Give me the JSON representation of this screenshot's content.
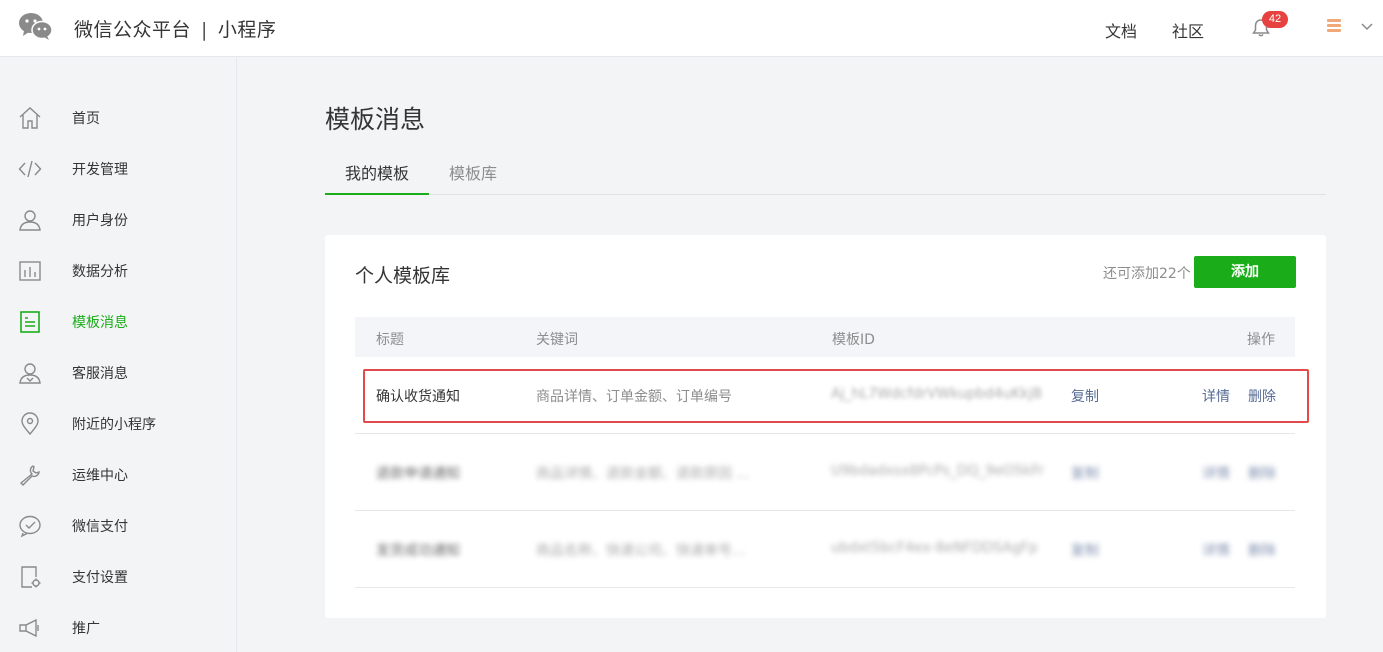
{
  "header": {
    "brand": "微信公众平台",
    "separator": "|",
    "product": "小程序",
    "links": {
      "docs": "文档",
      "community": "社区"
    },
    "notification_count": "42"
  },
  "sidebar": {
    "items": [
      {
        "label": "首页",
        "icon": "home-icon"
      },
      {
        "label": "开发管理",
        "icon": "code-icon"
      },
      {
        "label": "用户身份",
        "icon": "user-icon"
      },
      {
        "label": "数据分析",
        "icon": "chart-icon"
      },
      {
        "label": "模板消息",
        "icon": "template-icon",
        "active": true
      },
      {
        "label": "客服消息",
        "icon": "service-icon"
      },
      {
        "label": "附近的小程序",
        "icon": "location-icon"
      },
      {
        "label": "运维中心",
        "icon": "wrench-icon"
      },
      {
        "label": "微信支付",
        "icon": "pay-icon"
      },
      {
        "label": "支付设置",
        "icon": "pay-settings-icon"
      },
      {
        "label": "推广",
        "icon": "megaphone-icon"
      }
    ]
  },
  "main": {
    "title": "模板消息",
    "tabs": [
      {
        "label": "我的模板",
        "active": true
      },
      {
        "label": "模板库",
        "active": false
      }
    ],
    "card": {
      "title": "个人模板库",
      "remaining": "还可添加22个",
      "add_button": "添加",
      "columns": [
        "标题",
        "关键词",
        "模板ID",
        "操作"
      ],
      "rows": [
        {
          "title": "确认收货通知",
          "keywords": "商品详情、订单金额、订单编号",
          "template_id": "Aj_hL7WdcfdrVWkupbd4uKkjB",
          "copy": "复制",
          "detail": "详情",
          "delete": "删除",
          "obscured": false
        },
        {
          "title": "退款申请通知",
          "keywords": "商品详情、退款金额、退款原因 ...",
          "template_id": "U9bdadxsx8PcPs_DQ_9eO5kFr",
          "copy": "复制",
          "detail": "详情",
          "delete": "删除",
          "obscured": true
        },
        {
          "title": "发货成功通知",
          "keywords": "商品名称、快递公司、快递单号...",
          "template_id": "ubdxt5bcF4ex-8eNFDDSAgFp",
          "copy": "复制",
          "detail": "详情",
          "delete": "删除",
          "obscured": true
        }
      ]
    }
  },
  "colors": {
    "accent": "#1aad19",
    "link": "#576b95",
    "badge": "#e64340",
    "highlight": "#e14b4b"
  }
}
